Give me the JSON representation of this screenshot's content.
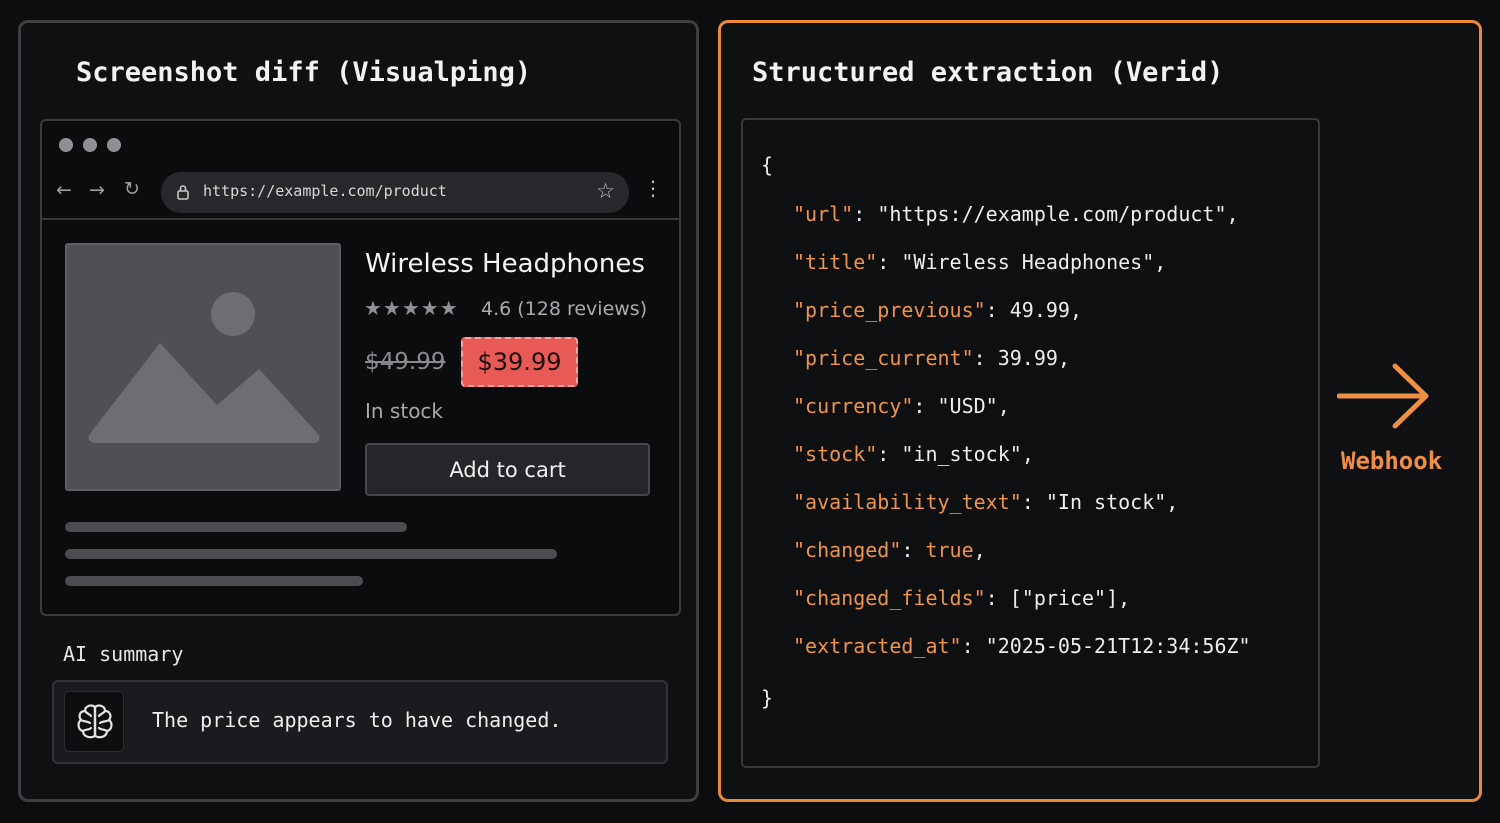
{
  "left_panel": {
    "title": "Screenshot diff (Visualping)",
    "browser": {
      "url": "https://example.com/product",
      "product": {
        "name": "Wireless Headphones",
        "rating_value": 4.6,
        "rating_text": "4.6 (128 reviews)",
        "old_price": "$49.99",
        "new_price": "$39.99",
        "stock": "In stock",
        "add_to_cart": "Add to cart"
      }
    },
    "ai_summary": {
      "label": "AI summary",
      "text": "The price appears to have changed."
    }
  },
  "right_panel": {
    "title": "Structured extraction (Verid)",
    "json_lines": [
      {
        "key": "url",
        "value": "\"https://example.com/product\"",
        "comma": ","
      },
      {
        "key": "title",
        "value": "\"Wireless Headphones\"",
        "comma": ","
      },
      {
        "key": "price_previous",
        "value": "49.99",
        "comma": ","
      },
      {
        "key": "price_current",
        "value": "39.99",
        "comma": ","
      },
      {
        "key": "currency",
        "value": "\"USD\"",
        "comma": ","
      },
      {
        "key": "stock",
        "value": "\"in_stock\"",
        "comma": ","
      },
      {
        "key": "availability_text",
        "value": "\"In stock\"",
        "comma": ","
      },
      {
        "key": "changed",
        "value": "true",
        "comma": ","
      },
      {
        "key": "changed_fields",
        "value": "[\"price\"]",
        "comma": ","
      },
      {
        "key": "extracted_at",
        "value": "\"2025-05-21T12:34:56Z\"",
        "comma": ""
      }
    ],
    "open_brace": "{",
    "close_brace": "}",
    "webhook_label": "Webhook"
  },
  "colors": {
    "accent": "#e8893a",
    "price_highlight": "#e85a55"
  },
  "icons": [
    "back-arrow-icon",
    "forward-arrow-icon",
    "reload-icon",
    "lock-icon",
    "star-icon",
    "menu-icon",
    "image-placeholder-icon",
    "brain-icon",
    "right-arrow-icon"
  ]
}
